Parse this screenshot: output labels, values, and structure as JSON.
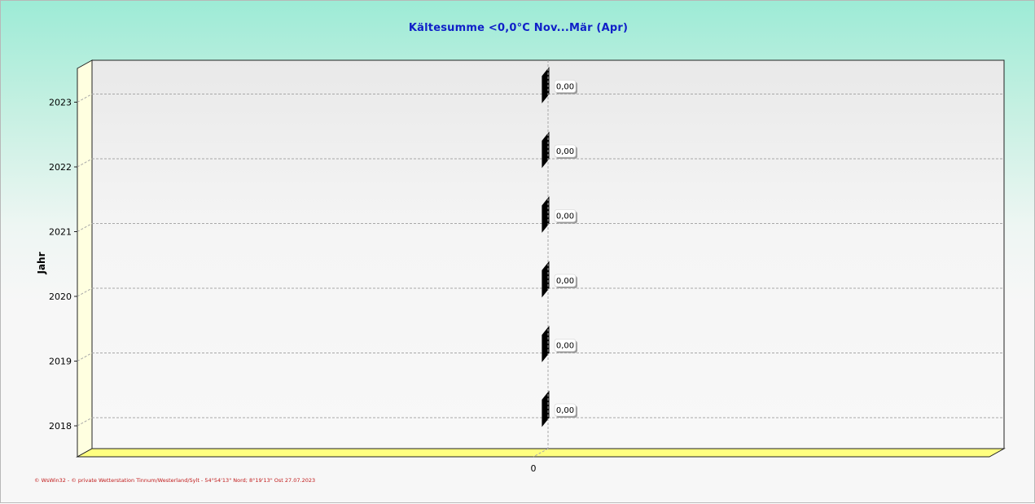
{
  "chart_data": {
    "type": "bar",
    "orientation": "horizontal",
    "title": "Kältesumme  <0,0°C  Nov...Mär (Apr)",
    "ylabel": "Jahr",
    "xlabel": "",
    "categories": [
      "2018",
      "2019",
      "2020",
      "2021",
      "2022",
      "2023"
    ],
    "values": [
      0.0,
      0.0,
      0.0,
      0.0,
      0.0,
      0.0
    ],
    "data_labels": [
      "0,00",
      "0,00",
      "0,00",
      "0,00",
      "0,00",
      "0,00"
    ],
    "x_ticks": [
      "0"
    ],
    "xlim": [
      -1,
      1
    ],
    "grid": true,
    "legend": "none",
    "colors": {
      "bar": "#000000",
      "floor": "#ffff80",
      "left_wall": "#ffffe0",
      "title": "#1020c8",
      "footer": "#c01818"
    }
  },
  "footer": "© WsWin32 - © private Wetterstation Tinnum/Westerland/Sylt - 54°54'13\" Nord; 8°19'13\" Ost 27.07.2023"
}
